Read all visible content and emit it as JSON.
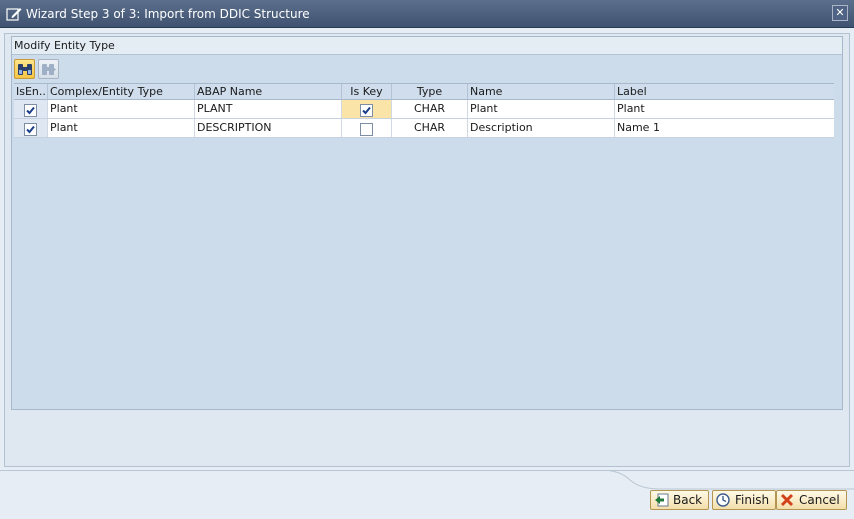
{
  "window": {
    "title": "Wizard Step 3 of 3: Import from DDIC Structure",
    "close_label": "✕"
  },
  "group": {
    "title": "Modify Entity Type"
  },
  "toolbar": {
    "buttons": [
      {
        "icon": "binoculars-find-icon",
        "enabled": true
      },
      {
        "icon": "find-next-icon",
        "enabled": false
      }
    ]
  },
  "table": {
    "headers": [
      "IsEn...",
      "Complex/Entity Type",
      "ABAP Name",
      "Is Key",
      "Type",
      "Name",
      "Label"
    ],
    "rows": [
      {
        "is_entity": true,
        "complex_entity_type": "Plant",
        "abap_name": "PLANT",
        "is_key": true,
        "type": "CHAR",
        "name": "Plant",
        "label": "Plant"
      },
      {
        "is_entity": true,
        "complex_entity_type": "Plant",
        "abap_name": "DESCRIPTION",
        "is_key": false,
        "type": "CHAR",
        "name": "Description",
        "label": "Name 1"
      }
    ]
  },
  "buttons": {
    "back": "Back",
    "finish": "Finish",
    "cancel": "Cancel"
  },
  "colors": {
    "titlebar": "#4a5d7c",
    "accent_button": "#f5c543",
    "focus_cell": "#fbe4a8"
  }
}
